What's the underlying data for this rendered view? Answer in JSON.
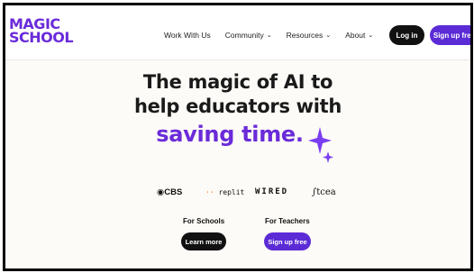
{
  "brand": {
    "line1": "MAGIC",
    "line2": "SCHOOL",
    "color": "#6a2bd9"
  },
  "nav": {
    "items": [
      {
        "label": "Work With Us",
        "dropdown": false
      },
      {
        "label": "Community",
        "dropdown": true
      },
      {
        "label": "Resources",
        "dropdown": true
      },
      {
        "label": "About",
        "dropdown": true
      }
    ],
    "login_label": "Log in",
    "signup_label": "Sign up free"
  },
  "hero": {
    "line1": "The magic of AI to",
    "line2": "help educators with",
    "accent": "saving time.",
    "accent_color": "#6a2bd9"
  },
  "partners": {
    "cbs": "CBS",
    "replit": "replit",
    "wired": "WIRED",
    "tcea": "tcea"
  },
  "cta": {
    "schools_label": "For Schools",
    "schools_button": "Learn more",
    "teachers_label": "For Teachers",
    "teachers_button": "Sign up free"
  },
  "colors": {
    "primary_purple": "#5b2bd6",
    "dark": "#111111",
    "background": "#fdfbf7"
  },
  "icons": [
    "chevron-down-icon",
    "sparkle-icon",
    "cbs-eye-icon",
    "replit-icon",
    "tcea-swoosh-icon"
  ]
}
